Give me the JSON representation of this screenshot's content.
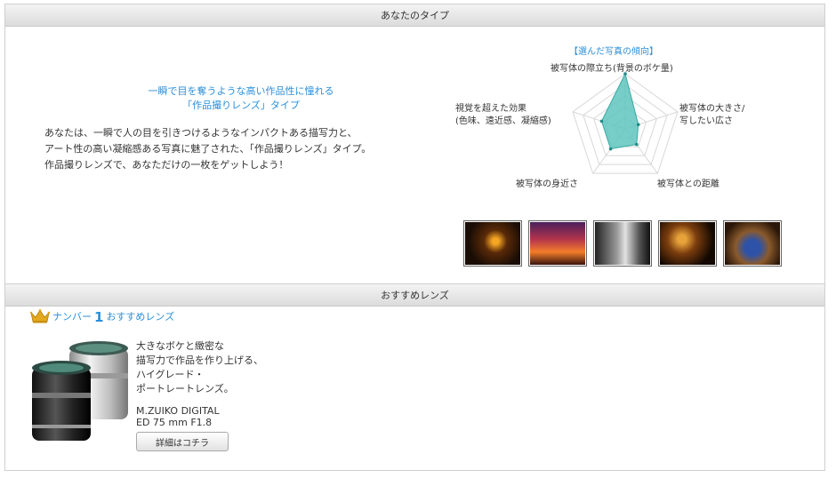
{
  "panels": {
    "type_header": "あなたのタイプ",
    "lens_header": "おすすめレンズ"
  },
  "type_result": {
    "headline_1": "一瞬で目を奪うような高い作品性に憧れる",
    "headline_2": "「作品撮りレンズ」タイプ",
    "desc_1": "あなたは、一瞬で人の目を引きつけるようなインパクトある描写力と、",
    "desc_2": "アート性の高い凝縮感ある写真に魅了された、「作品撮りレンズ」タイプ。",
    "desc_3": "作品撮りレンズで、あなただけの一枚をゲットしよう！"
  },
  "radar": {
    "title": "【選んだ写真の傾向】",
    "axes": [
      {
        "label_1": "被写体の際立ち(背景のボケ量)",
        "label_2": "",
        "value": 1.0
      },
      {
        "label_1": "被写体の大きさ/",
        "label_2": "写したい広さ",
        "value": 0.25
      },
      {
        "label_1": "被写体との距離",
        "label_2": "",
        "value": 0.35
      },
      {
        "label_1": "被写体の身近さ",
        "label_2": "",
        "value": 0.45
      },
      {
        "label_1": "視覚を超えた効果",
        "label_2": "(色味、遠近感、凝縮感)",
        "value": 0.45
      }
    ],
    "fill_color": "#5fc4be",
    "grid_levels": 5
  },
  "lens": {
    "rank_label": "ナンバー",
    "rank_number": "1",
    "rank_suffix": "おすすめレンズ",
    "copy_1": "大きなボケと緻密な",
    "copy_2": "描写力で作品を作り上げる、",
    "copy_3": "ハイグレード・",
    "copy_4": "ポートレートレンズ。",
    "name_1": "M.ZUIKO DIGITAL",
    "name_2": "ED 75 mm F1.8",
    "button_label": "詳細はコチラ"
  }
}
